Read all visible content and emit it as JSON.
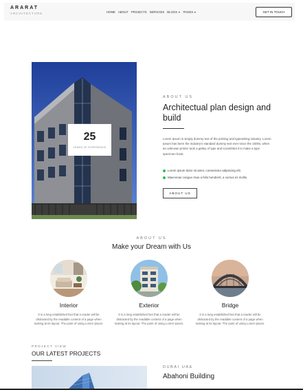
{
  "brand": {
    "name": "ARARAT",
    "tagline": "ARCHITECTURE"
  },
  "nav": {
    "items": [
      {
        "label": "HOME"
      },
      {
        "label": "ABOUT"
      },
      {
        "label": "PROJECTS"
      },
      {
        "label": "SERVICES"
      },
      {
        "label": "BLOGS",
        "dropdown": true
      },
      {
        "label": "PAGES",
        "dropdown": true
      }
    ],
    "cta_label": "GET IN TOUCH"
  },
  "about": {
    "experience_number": "25",
    "experience_label": "YEARS OF EXPERIENCE",
    "eyebrow": "ABOUT US",
    "title": "Architectual plan design and build",
    "description": "Lorem Ipsum is simply dummy text of the printing and typesetting industry. Lorem Ipsum has been the industry's standard dummy text ever since the 1500s, when an unknown printer took a galley of type and scrambled it to make a type specimen book.",
    "bullets": [
      "Lorem ipsum dolor sit amet, consectetur adipiscing elit.",
      "Maecenas congue risus a felis hendrerit, a cursus mi mollis."
    ],
    "button_label": "ABOUT US",
    "bullet_color": "#2bbf4f"
  },
  "services": {
    "eyebrow": "ABOUT US",
    "title": "Make your Dream with Us",
    "items": [
      {
        "title": "Interior",
        "text": "It is a long established fact that a reader will be distracted by the readable content of a page when looking at its layout. The point of using Lorem Ipsum."
      },
      {
        "title": "Exterior",
        "text": "It is a long established fact that a reader will be distracted by the readable content of a page when looking at its layout. The point of using Lorem Ipsum."
      },
      {
        "title": "Bridge",
        "text": "It is a long established fact that a reader will be distracted by the readable content of a page when looking at its layout. The point of using Lorem Ipsum."
      }
    ]
  },
  "projects": {
    "eyebrow": "PROJECT VIEW",
    "title": "OUR LATEST PROJECTS",
    "featured_location": "DUBAI UAE",
    "featured_name": "Abahoni Building"
  }
}
